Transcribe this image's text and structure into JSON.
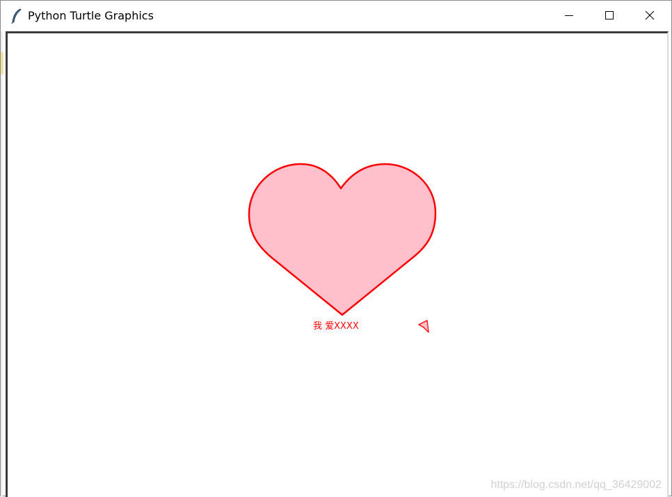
{
  "window": {
    "title": "Python Turtle Graphics",
    "app_icon": "feather-icon",
    "controls": {
      "minimize_icon": "minimize-icon",
      "maximize_icon": "maximize-icon",
      "close_icon": "close-icon"
    }
  },
  "canvas": {
    "heart": {
      "fill_color": "#ffc0cb",
      "stroke_color": "#ff0000"
    },
    "caption": "我 爱XXXX",
    "caption_color": "#ff0000",
    "turtle_icon": "turtle-arrow-icon",
    "turtle_color": "#ff0000"
  },
  "watermark": "https://blog.csdn.net/qq_36429002"
}
